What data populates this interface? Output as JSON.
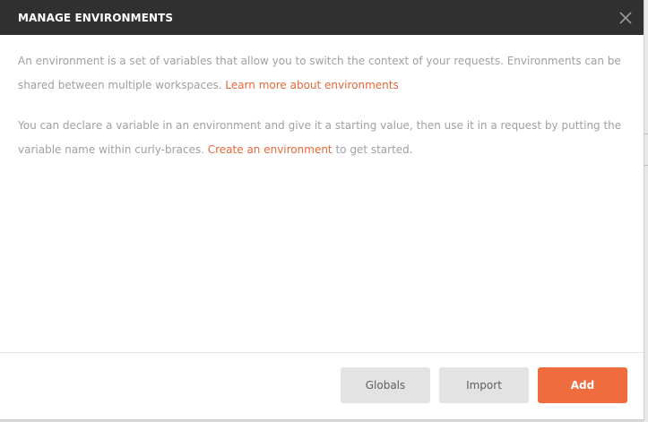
{
  "dialog": {
    "title": "MANAGE ENVIRONMENTS",
    "close_icon": "close-icon"
  },
  "body": {
    "para1_text": "An environment is a set of variables that allow you to switch the context of your requests. Environments can be shared between multiple workspaces. ",
    "para1_link": "Learn more about environments",
    "para2_text_before": "You can declare a variable in an environment and give it a starting value, then use it in a request by putting the variable name within curly-braces. ",
    "para2_link": "Create an environment",
    "para2_text_after": " to get started."
  },
  "footer": {
    "globals_label": "Globals",
    "import_label": "Import",
    "add_label": "Add"
  },
  "colors": {
    "header_bg": "#303030",
    "accent": "#ef6c3e",
    "link": "#e5683a",
    "body_text": "#a0a0a0",
    "secondary_button": "#e3e3e3"
  }
}
